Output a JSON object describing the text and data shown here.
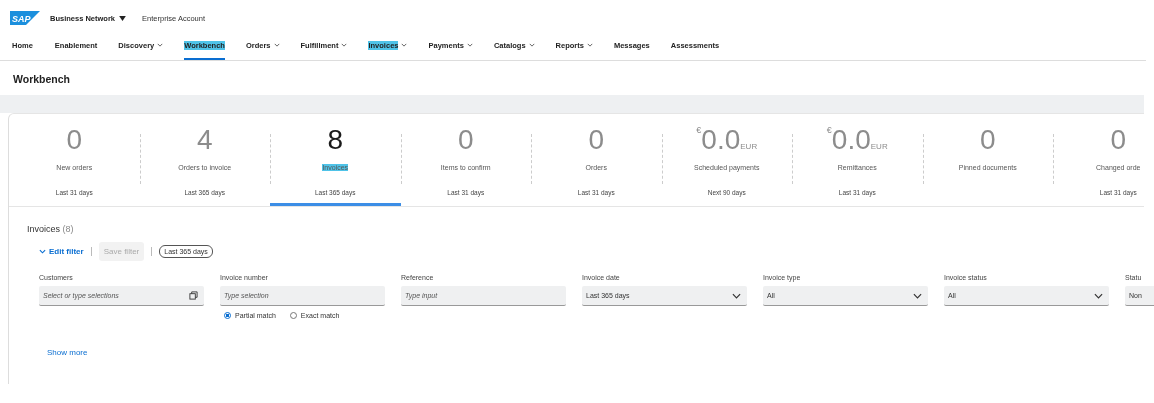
{
  "header": {
    "logo": "SAP",
    "product": "Business Network",
    "account": "Enterprise Account"
  },
  "nav": [
    {
      "label": "Home",
      "dropdown": false,
      "selected": false,
      "highlighted": false
    },
    {
      "label": "Enablement",
      "dropdown": false,
      "selected": false,
      "highlighted": false
    },
    {
      "label": "Discovery",
      "dropdown": true,
      "selected": false,
      "highlighted": false
    },
    {
      "label": "Workbench",
      "dropdown": false,
      "selected": true,
      "highlighted": true
    },
    {
      "label": "Orders",
      "dropdown": true,
      "selected": false,
      "highlighted": false
    },
    {
      "label": "Fulfillment",
      "dropdown": true,
      "selected": false,
      "highlighted": false
    },
    {
      "label": "Invoices",
      "dropdown": true,
      "selected": false,
      "highlighted": true
    },
    {
      "label": "Payments",
      "dropdown": true,
      "selected": false,
      "highlighted": false
    },
    {
      "label": "Catalogs",
      "dropdown": true,
      "selected": false,
      "highlighted": false
    },
    {
      "label": "Reports",
      "dropdown": true,
      "selected": false,
      "highlighted": false
    },
    {
      "label": "Messages",
      "dropdown": false,
      "selected": false,
      "highlighted": false
    },
    {
      "label": "Assessments",
      "dropdown": false,
      "selected": false,
      "highlighted": false
    }
  ],
  "page_title": "Workbench",
  "tiles": [
    {
      "value": "0",
      "label": "New orders",
      "period": "Last 31 days",
      "selected": false,
      "highlighted": false
    },
    {
      "value": "4",
      "label": "Orders to invoice",
      "period": "Last 365 days",
      "selected": false,
      "highlighted": false
    },
    {
      "value": "8",
      "label": "Invoices",
      "period": "Last 365 days",
      "selected": true,
      "highlighted": true
    },
    {
      "value": "0",
      "label": "Items to confirm",
      "period": "Last 31 days",
      "selected": false,
      "highlighted": false
    },
    {
      "value": "0",
      "label": "Orders",
      "period": "Last 31 days",
      "selected": false,
      "highlighted": false
    },
    {
      "currency": "€",
      "value": "0.0",
      "unit": "EUR",
      "label": "Scheduled payments",
      "period": "Next 90 days",
      "selected": false,
      "highlighted": false
    },
    {
      "currency": "€",
      "value": "0.0",
      "unit": "EUR",
      "label": "Remittances",
      "period": "Last 31 days",
      "selected": false,
      "highlighted": false
    },
    {
      "value": "0",
      "label": "Pinned documents",
      "selected": false,
      "highlighted": false
    },
    {
      "value": "0",
      "label": "Changed orde",
      "period": "Last 31 days",
      "selected": false,
      "highlighted": false
    }
  ],
  "section": {
    "title": "Invoices",
    "count": "(8)"
  },
  "filter_bar": {
    "edit": "Edit filter",
    "save": "Save filter",
    "save_disabled": true,
    "chip": "Last 365 days"
  },
  "filters": [
    {
      "label": "Customers",
      "kind": "multi",
      "placeholder": "Select or type selections"
    },
    {
      "label": "Invoice number",
      "kind": "text",
      "placeholder": "Type selection",
      "options": [
        {
          "label": "Partial match",
          "selected": true
        },
        {
          "label": "Exact match",
          "selected": false
        }
      ]
    },
    {
      "label": "Reference",
      "kind": "text",
      "placeholder": "Type input"
    },
    {
      "label": "Invoice date",
      "kind": "select",
      "value": "Last 365 days"
    },
    {
      "label": "Invoice type",
      "kind": "select",
      "value": "All"
    },
    {
      "label": "Invoice status",
      "kind": "select",
      "value": "All"
    },
    {
      "label": "Statu",
      "kind": "cut",
      "value": "Non"
    }
  ],
  "show_more": "Show more"
}
